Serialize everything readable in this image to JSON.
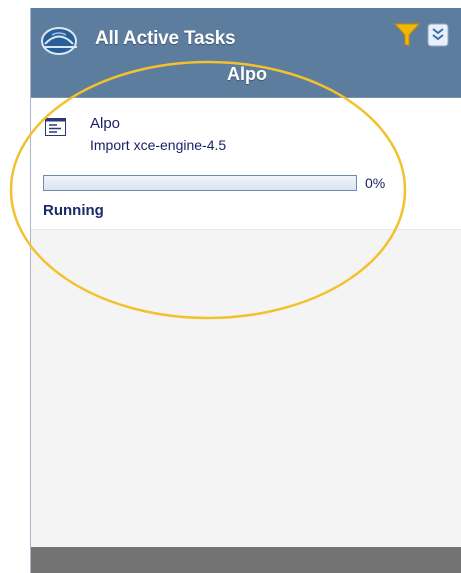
{
  "header": {
    "title": "All Active Tasks",
    "subtitle": "Alpo",
    "icon": "hard-hat-icon",
    "filter_icon": "filter-icon",
    "expand_icon": "expand-down-icon"
  },
  "task": {
    "icon": "task-list-icon",
    "name": "Alpo",
    "description": "Import xce-engine-4.5",
    "progress_text": "0%",
    "progress": 0,
    "status": "Running"
  },
  "colors": {
    "header_bg": "#5d7d9f",
    "highlight": "#f2c12e",
    "filter_funnel": "#f2b705",
    "status_text": "#1a2b6b"
  }
}
